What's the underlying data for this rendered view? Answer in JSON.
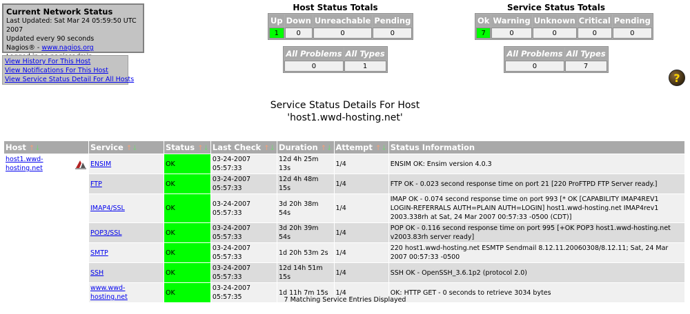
{
  "info": {
    "title": "Current Network Status",
    "last_updated": "Last Updated: Sat Mar 24 05:59:50 UTC 2007",
    "update_interval": "Updated every 90 seconds",
    "nagios_prefix": "Nagios® - ",
    "nagios_link": "www.nagios.org",
    "logged_in_prefix": "Logged in as ",
    "user": "nagiosadmin"
  },
  "links": [
    "View History For This Host",
    "View Notifications For This Host",
    "View Service Status Detail For All Hosts"
  ],
  "host_totals": {
    "title": "Host Status Totals",
    "headers": [
      "Up",
      "Down",
      "Unreachable",
      "Pending"
    ],
    "values": [
      "1",
      "0",
      "0",
      "0"
    ],
    "problem_headers": [
      "All Problems",
      "All Types"
    ],
    "problem_values": [
      "0",
      "1"
    ]
  },
  "service_totals": {
    "title": "Service Status Totals",
    "headers": [
      "Ok",
      "Warning",
      "Unknown",
      "Critical",
      "Pending"
    ],
    "values": [
      "7",
      "0",
      "0",
      "0",
      "0"
    ],
    "problem_headers": [
      "All Problems",
      "All Types"
    ],
    "problem_values": [
      "0",
      "7"
    ]
  },
  "help_icon_label": "?",
  "page_title": {
    "line1": "Service Status Details For Host",
    "line2": "'host1.wwd-hosting.net'"
  },
  "table": {
    "headers": [
      "Host",
      "Service",
      "Status",
      "Last Check",
      "Duration",
      "Attempt",
      "Status Information"
    ],
    "host": "host1.wwd-hosting.net",
    "rows": [
      {
        "service": "ENSIM",
        "status": "OK",
        "last_check": "03-24-2007 05:57:33",
        "duration": "12d 4h 25m 13s",
        "attempt": "1/4",
        "info": "ENSIM OK: Ensim version 4.0.3"
      },
      {
        "service": "FTP",
        "status": "OK",
        "last_check": "03-24-2007 05:57:33",
        "duration": "12d 4h 48m 15s",
        "attempt": "1/4",
        "info": "FTP OK - 0.023 second response time on port 21 [220 ProFTPD FTP Server ready.]"
      },
      {
        "service": "IMAP4/SSL",
        "status": "OK",
        "last_check": "03-24-2007 05:57:33",
        "duration": "3d 20h 38m 54s",
        "attempt": "1/4",
        "info": "IMAP OK - 0.074 second response time on port 993 [* OK [CAPABILITY IMAP4REV1 LOGIN-REFERRALS AUTH=PLAIN AUTH=LOGIN] host1.wwd-hosting.net IMAP4rev1 2003.338rh at Sat, 24 Mar 2007 00:57:33 -0500 (CDT)]"
      },
      {
        "service": "POP3/SSL",
        "status": "OK",
        "last_check": "03-24-2007 05:57:33",
        "duration": "3d 20h 39m 54s",
        "attempt": "1/4",
        "info": "POP OK - 0.116 second response time on port 995 [+OK POP3 host1.wwd-hosting.net v2003.83rh server ready]"
      },
      {
        "service": "SMTP",
        "status": "OK",
        "last_check": "03-24-2007 05:57:33",
        "duration": "1d 20h 53m 2s",
        "attempt": "1/4",
        "info": "220 host1.wwd-hosting.net ESMTP Sendmail 8.12.11.20060308/8.12.11; Sat, 24 Mar 2007 00:57:33 -0500"
      },
      {
        "service": "SSH",
        "status": "OK",
        "last_check": "03-24-2007 05:57:33",
        "duration": "12d 14h 51m 15s",
        "attempt": "1/4",
        "info": "SSH OK - OpenSSH_3.6.1p2 (protocol 2.0)"
      },
      {
        "service": "www.wwd-hosting.net",
        "status": "OK",
        "last_check": "03-24-2007 05:57:35",
        "duration": "1d 11h 7m 15s",
        "attempt": "1/4",
        "info": "OK: HTTP GET - 0 seconds to retrieve 3034 bytes"
      }
    ]
  },
  "footer": "7 Matching Service Entries Displayed",
  "colors": {
    "ok_green": "#00ff00",
    "header_gray": "#a9a9a9",
    "row_light": "#f0f0f0",
    "row_dark": "#dcdcdc",
    "link_blue": "#0000ee"
  }
}
